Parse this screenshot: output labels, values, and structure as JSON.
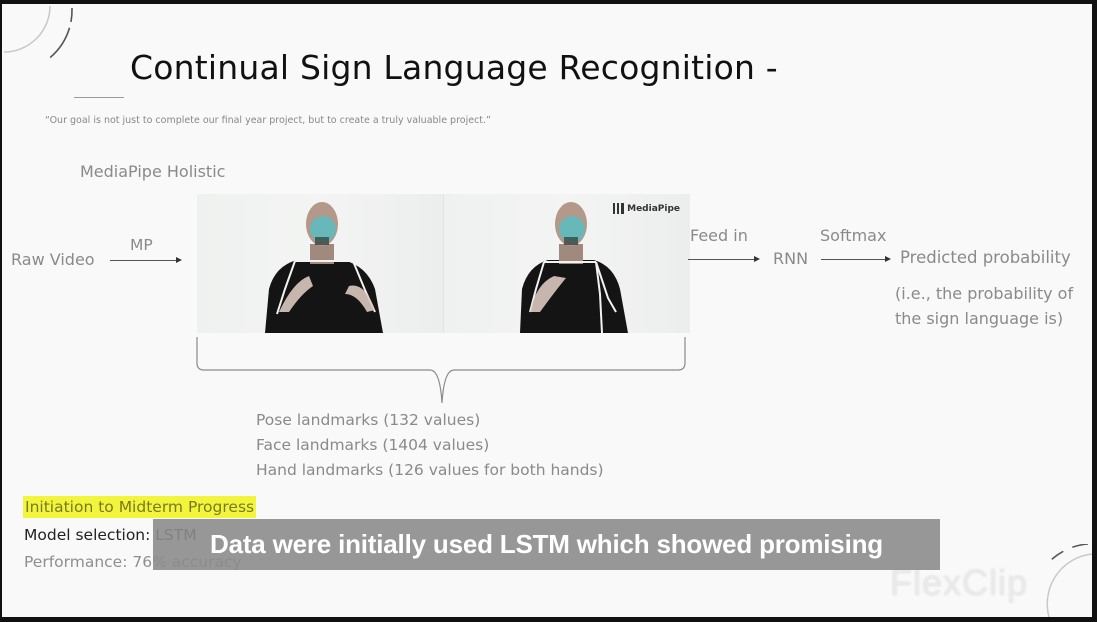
{
  "slide": {
    "title": "Continual Sign Language Recognition -",
    "quote": "“Our goal is not just to complete our final year project, but to create a truly valuable project.”",
    "pipeline": {
      "label_mediapipe": "MediaPipe Holistic",
      "input": "Raw Video",
      "arrow1_label": "MP",
      "video_logo": "MediaPipe",
      "arrow2_label": "Feed in",
      "model": "RNN",
      "arrow3_label": "Softmax",
      "output": "Predicted probability",
      "output_note_line1": "(i.e., the probability of",
      "output_note_line2": "the sign language is)"
    },
    "landmarks": [
      "Pose landmarks (132 values)",
      "Face landmarks (1404 values)",
      "Hand landmarks (126 values for both hands)"
    ],
    "progress": {
      "heading": "Initiation to Midterm Progress",
      "model_selection": "Model selection: LSTM",
      "performance": "Performance: 76% accuracy"
    }
  },
  "overlay": {
    "caption": "Data were initially used LSTM which showed promising",
    "watermark": "FlexClip"
  },
  "colors": {
    "highlight": "#f2f53c",
    "caption_bg": "#8c8c8c",
    "body_text": "#8a8a8a",
    "title_text": "#111111",
    "face_mesh": "#4fc3c8"
  }
}
